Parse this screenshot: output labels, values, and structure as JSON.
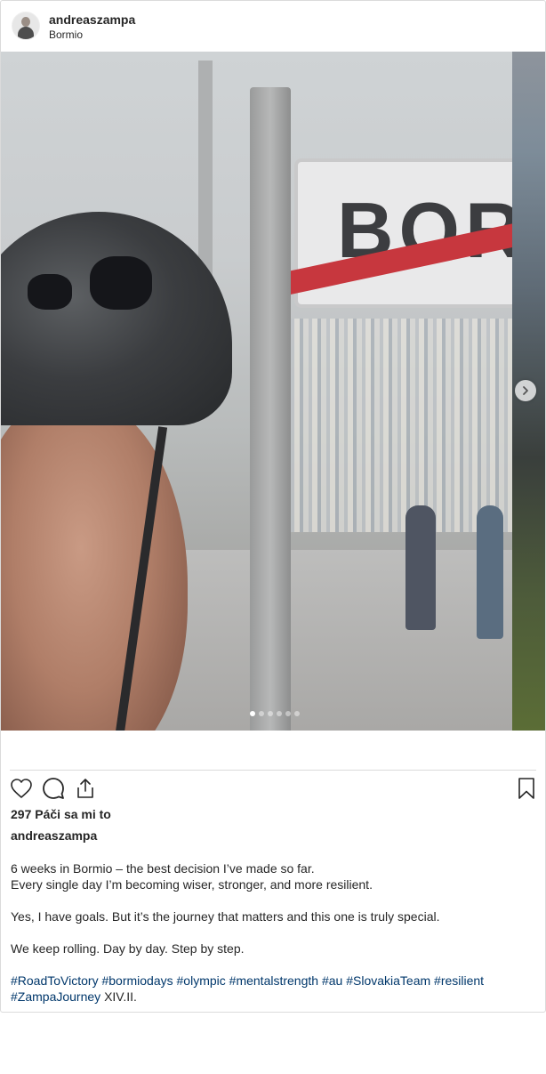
{
  "header": {
    "username": "andreaszampa",
    "location": "Bormio"
  },
  "media": {
    "sign_text": "BORMI",
    "carousel_count": 6,
    "carousel_active": 1
  },
  "engagement": {
    "likes_text": "297 Páči sa mi to"
  },
  "caption": {
    "username": "andreaszampa",
    "line1": "6 weeks in Bormio – the best decision I’ve made so far.",
    "line2": "Every single day I’m becoming wiser, stronger, and more resilient.",
    "line3": "Yes, I have goals. But it’s the journey that matters and this one is truly special.",
    "line4": "We keep rolling. Day by day. Step by step.",
    "hashtags": [
      "#RoadToVictory",
      "#bormiodays",
      "#olympic",
      "#mentalstrength",
      "#au",
      "#SlovakiaTeam",
      "#resilient",
      "#ZampaJourney"
    ],
    "suffix": "XIV.II."
  },
  "icons": {
    "like": "heart-icon",
    "comment": "comment-icon",
    "share": "share-icon",
    "save": "bookmark-icon",
    "next": "chevron-right-icon"
  }
}
